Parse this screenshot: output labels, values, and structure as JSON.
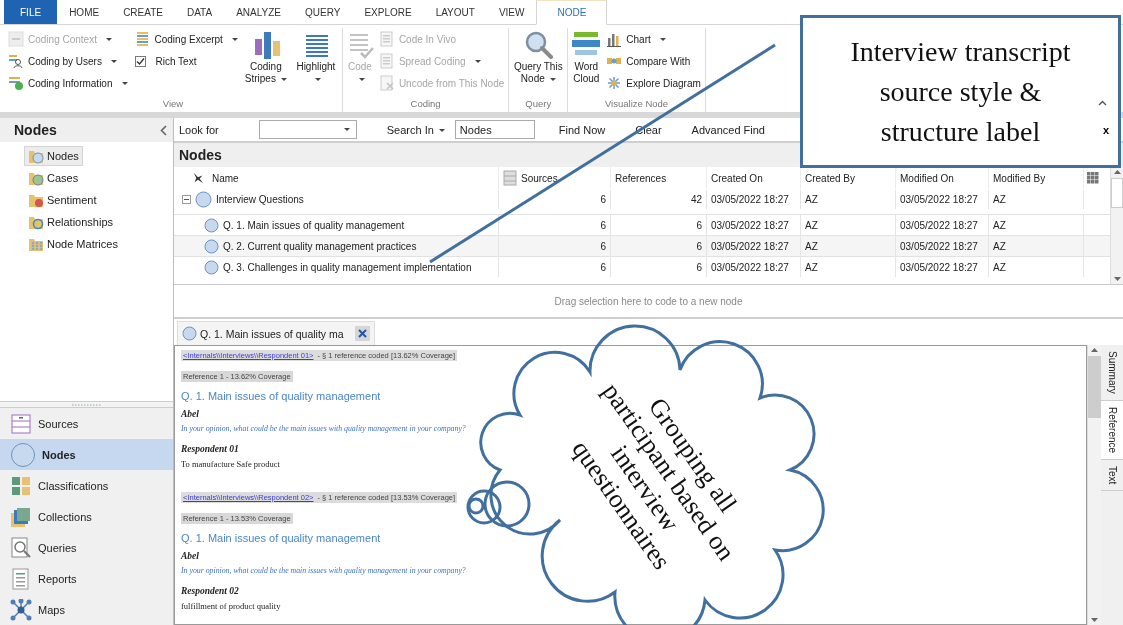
{
  "ribbon": {
    "tabs": [
      {
        "label": "FILE",
        "kind": "file",
        "selected": false
      },
      {
        "label": "HOME",
        "kind": "tab",
        "selected": false
      },
      {
        "label": "CREATE",
        "kind": "tab",
        "selected": false
      },
      {
        "label": "DATA",
        "kind": "tab",
        "selected": false
      },
      {
        "label": "ANALYZE",
        "kind": "tab",
        "selected": false
      },
      {
        "label": "QUERY",
        "kind": "tab",
        "selected": false
      },
      {
        "label": "EXPLORE",
        "kind": "tab",
        "selected": false
      },
      {
        "label": "LAYOUT",
        "kind": "tab",
        "selected": false
      },
      {
        "label": "VIEW",
        "kind": "tab",
        "selected": false
      },
      {
        "label": "NODE",
        "kind": "tab",
        "selected": true
      }
    ],
    "groups": [
      {
        "label": "View",
        "items": [
          {
            "label": "Coding Context",
            "kind": "small",
            "disabled": true,
            "dropdown": true
          },
          {
            "label": "Coding by Users",
            "kind": "small",
            "disabled": false,
            "dropdown": true
          },
          {
            "label": "Coding Information",
            "kind": "small",
            "disabled": false,
            "dropdown": true
          },
          {
            "label": "Coding Excerpt",
            "kind": "small",
            "disabled": false,
            "dropdown": true
          },
          {
            "label": "Rich Text",
            "kind": "check",
            "checked": true
          },
          {
            "label": "Coding Stripes",
            "kind": "large",
            "disabled": false,
            "dropdown": true
          },
          {
            "label": "Highlight",
            "kind": "large",
            "disabled": false,
            "dropdown": true
          }
        ]
      },
      {
        "label": "Coding",
        "items": [
          {
            "label": "Code",
            "kind": "large",
            "disabled": true,
            "dropdown": true
          },
          {
            "label": "Code In Vivo",
            "kind": "small",
            "disabled": true,
            "dropdown": false
          },
          {
            "label": "Spread Coding",
            "kind": "small",
            "disabled": true,
            "dropdown": true
          },
          {
            "label": "Uncode from This Node",
            "kind": "small",
            "disabled": true,
            "dropdown": false
          }
        ]
      },
      {
        "label": "Query",
        "items": [
          {
            "label": "Query This Node",
            "kind": "large",
            "disabled": false,
            "dropdown": true
          }
        ]
      },
      {
        "label": "Visualize Node",
        "items": [
          {
            "label": "Word Cloud",
            "kind": "large",
            "disabled": false,
            "dropdown": false
          },
          {
            "label": "Chart",
            "kind": "small",
            "disabled": false,
            "dropdown": true
          },
          {
            "label": "Compare With",
            "kind": "small",
            "disabled": false,
            "dropdown": false
          },
          {
            "label": "Explore Diagram",
            "kind": "small",
            "disabled": false,
            "dropdown": false
          }
        ]
      }
    ]
  },
  "navigator": {
    "title": "Nodes",
    "items": [
      {
        "label": "Nodes",
        "selected": true
      },
      {
        "label": "Cases",
        "selected": false
      },
      {
        "label": "Sentiment",
        "selected": false
      },
      {
        "label": "Relationships",
        "selected": false
      },
      {
        "label": "Node Matrices",
        "selected": false
      }
    ],
    "sections": [
      {
        "label": "Sources",
        "selected": false
      },
      {
        "label": "Nodes",
        "selected": true
      },
      {
        "label": "Classifications",
        "selected": false
      },
      {
        "label": "Collections",
        "selected": false
      },
      {
        "label": "Queries",
        "selected": false
      },
      {
        "label": "Reports",
        "selected": false
      },
      {
        "label": "Maps",
        "selected": false
      }
    ]
  },
  "find_bar": {
    "look_for_label": "Look for",
    "search_in": "Search In",
    "search_in_value": "Nodes",
    "buttons": [
      "Find Now",
      "Clear",
      "Advanced Find"
    ],
    "close": "x"
  },
  "list": {
    "title": "Nodes",
    "columns": [
      "Name",
      "Sources",
      "References",
      "Created On",
      "Created By",
      "Modified On",
      "Modified By"
    ],
    "rows": [
      {
        "name": "Interview Questions",
        "sources": "6",
        "references": "42",
        "created_on": "03/05/2022 18:27",
        "created_by": "AZ",
        "modified_on": "03/05/2022 18:27",
        "modified_by": "AZ",
        "expanded": true,
        "children": [
          {
            "name": "Q. 1. Main issues of quality management",
            "sources": "6",
            "references": "6",
            "created_on": "03/05/2022 18:27",
            "created_by": "AZ",
            "modified_on": "03/05/2022 18:27",
            "modified_by": "AZ"
          },
          {
            "name": "Q. 2. Current quality management practices",
            "sources": "6",
            "references": "6",
            "created_on": "03/05/2022 18:27",
            "created_by": "AZ",
            "modified_on": "03/05/2022 18:27",
            "modified_by": "AZ"
          },
          {
            "name": "Q. 3. Challenges in quality management implementation",
            "sources": "6",
            "references": "6",
            "created_on": "03/05/2022 18:27",
            "created_by": "AZ",
            "modified_on": "03/05/2022 18:27",
            "modified_by": "AZ"
          }
        ]
      }
    ],
    "drop_hint": "Drag selection here to code to a new node"
  },
  "detail": {
    "tab": "Q. 1. Main issues of quality ma",
    "content": [
      {
        "kind": "source",
        "link": "<Internals\\\\Interviews\\\\Respondent 01>",
        "text": "- § 1 reference coded  [13.62% Coverage]"
      },
      {
        "kind": "reference",
        "text": "Reference 1 - 13.62% Coverage"
      },
      {
        "kind": "heading",
        "text": "Q. 1. Main issues of quality management"
      },
      {
        "kind": "speaker",
        "text": "Abel"
      },
      {
        "kind": "question",
        "text": "In your opinion, what could be the main issues with quality management in your company?"
      },
      {
        "kind": "speaker",
        "text": "Respondent 01"
      },
      {
        "kind": "answer",
        "text": "To manufacture Safe product"
      },
      {
        "kind": "source",
        "link": "<Internals\\\\Interviews\\\\Respondent 02>",
        "text": "- § 1 reference coded  [13.53% Coverage]"
      },
      {
        "kind": "reference",
        "text": "Reference 1 - 13.53% Coverage"
      },
      {
        "kind": "heading",
        "text": "Q. 1. Main issues of quality management"
      },
      {
        "kind": "speaker",
        "text": "Abel"
      },
      {
        "kind": "question",
        "text": "In your opinion, what could be the main issues with quality management in your company?"
      },
      {
        "kind": "speaker",
        "text": "Respondent 02"
      },
      {
        "kind": "answer",
        "text": "fulfillment of product quality"
      }
    ],
    "side_tabs": [
      {
        "label": "Summary",
        "selected": false
      },
      {
        "label": "Reference",
        "selected": true
      },
      {
        "label": "Text",
        "selected": false
      }
    ]
  },
  "annotations": {
    "callout": "Interview transcript source style & structure label",
    "cloud": "Grouping all participant based on interview questionnaires"
  }
}
